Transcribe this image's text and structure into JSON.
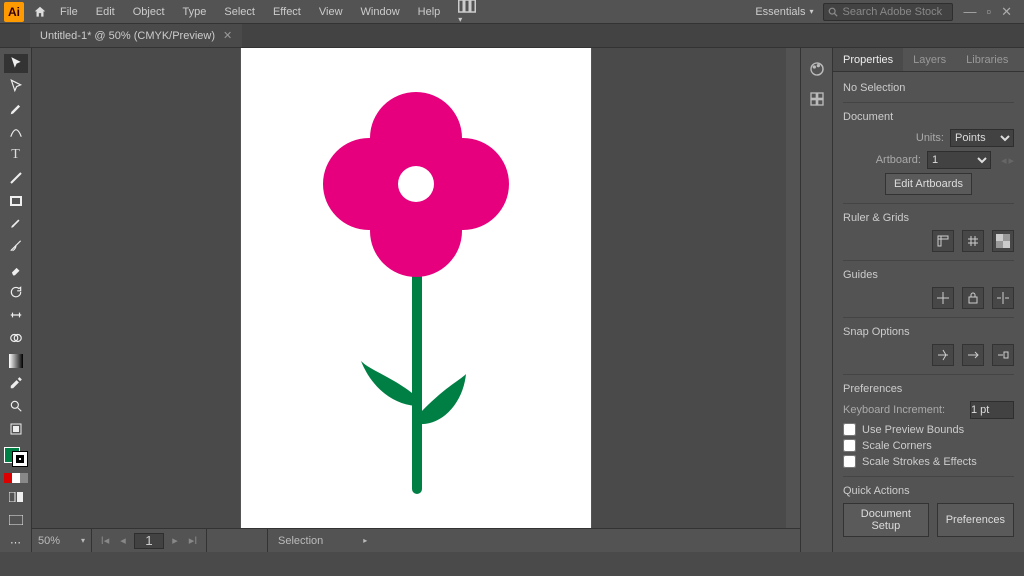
{
  "menubar": {
    "app_initials": "Ai",
    "items": [
      "File",
      "Edit",
      "Object",
      "Type",
      "Select",
      "Effect",
      "View",
      "Window",
      "Help"
    ],
    "workspace": "Essentials",
    "search_placeholder": "Search Adobe Stock"
  },
  "tab": {
    "title": "Untitled-1* @ 50% (CMYK/Preview)"
  },
  "tools": [
    "selection",
    "direct-selection",
    "magic-wand",
    "lasso",
    "pen",
    "curvature",
    "type",
    "line",
    "rectangle",
    "paintbrush",
    "shaper",
    "eraser",
    "rotate",
    "scale",
    "width",
    "free-transform",
    "shape-builder",
    "perspective",
    "mesh",
    "gradient",
    "eyedropper",
    "blend",
    "symbol-sprayer",
    "column-graph",
    "artboard",
    "slice",
    "hand",
    "zoom",
    "print-tiling"
  ],
  "artwork": {
    "petal_color": "#e6007e",
    "stem_color": "#007f44",
    "center_color": "#ffffff"
  },
  "status": {
    "zoom": "50%",
    "artboard": "1",
    "tool": "Selection"
  },
  "panel": {
    "tabs": [
      "Properties",
      "Layers",
      "Libraries"
    ],
    "active_tab": 0,
    "no_selection": "No Selection",
    "document_heading": "Document",
    "units_label": "Units:",
    "units_value": "Points",
    "artboard_label": "Artboard:",
    "artboard_value": "1",
    "edit_artboards": "Edit Artboards",
    "ruler_grids": "Ruler & Grids",
    "guides": "Guides",
    "snap_options": "Snap Options",
    "preferences_heading": "Preferences",
    "keyboard_increment_label": "Keyboard Increment:",
    "keyboard_increment_value": "1 pt",
    "use_preview_bounds": "Use Preview Bounds",
    "scale_corners": "Scale Corners",
    "scale_strokes": "Scale Strokes & Effects",
    "quick_actions": "Quick Actions",
    "document_setup_btn": "Document Setup",
    "preferences_btn": "Preferences"
  }
}
